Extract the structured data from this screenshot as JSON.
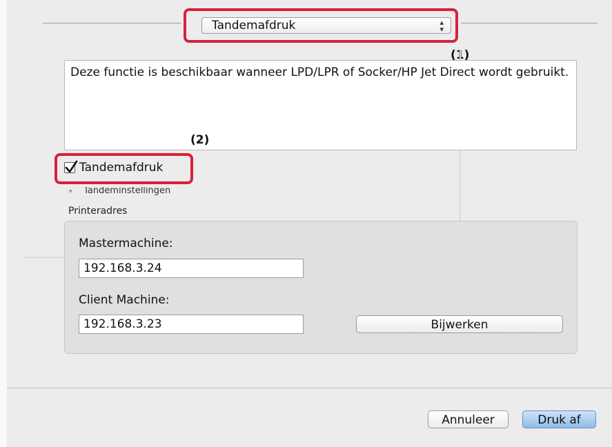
{
  "popup": {
    "selected": "Tandemafdruk"
  },
  "callouts": {
    "one": "(1)",
    "two": "(2)"
  },
  "description": "Deze functie is beschikbaar wanneer LPD/LPR of Socker/HP Jet Direct wordt gebruikt.",
  "tandem_checkbox": {
    "label": "Tandemafdruk",
    "checked": true
  },
  "tandem_settings_label": "Tandeminstellingen",
  "printer_address": {
    "title": "Printeradres",
    "master_label": "Mastermachine:",
    "master_value": "192.168.3.24",
    "client_label": "Client Machine:",
    "client_value": "192.168.3.23",
    "update_button": "Bijwerken"
  },
  "footer": {
    "cancel": "Annuleer",
    "print": "Druk af"
  },
  "colors": {
    "highlight": "#d6213b",
    "primary_button": "#8fbbe8"
  }
}
